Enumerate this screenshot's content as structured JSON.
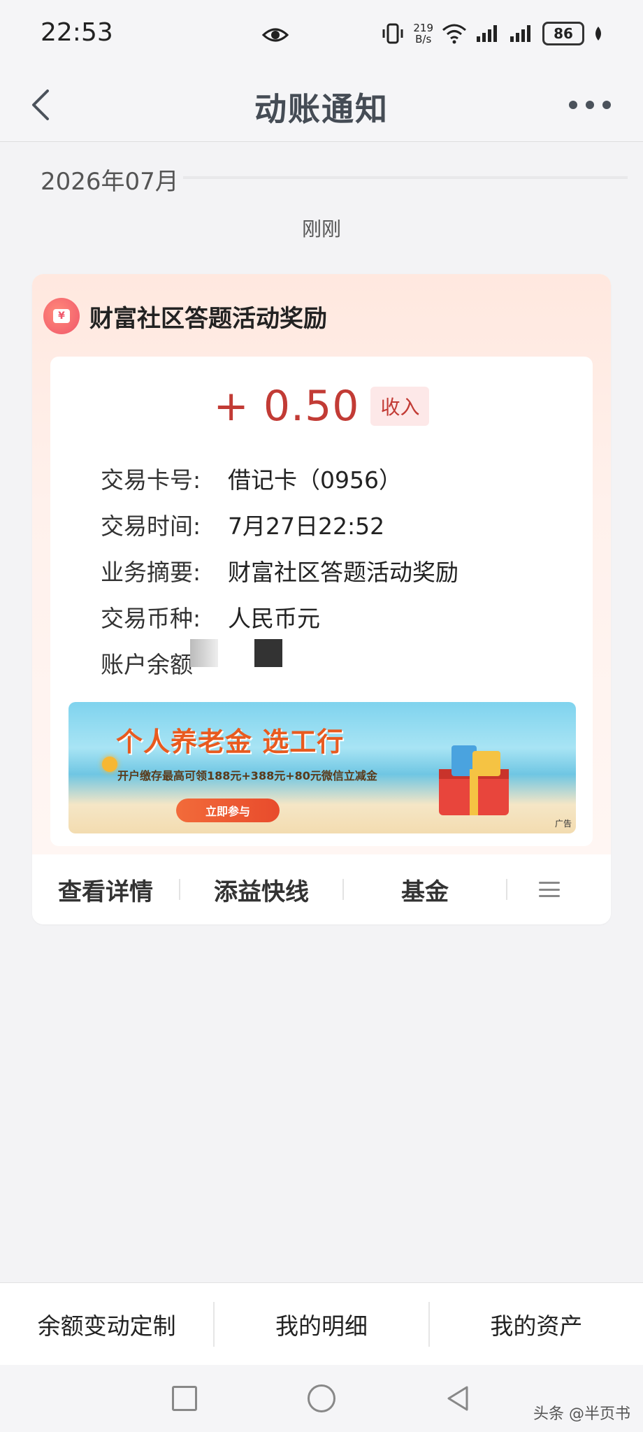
{
  "status_bar": {
    "time": "22:53",
    "net_speed_value": "219",
    "net_speed_unit": "B/s",
    "battery": "86",
    "icons": [
      "eye-icon",
      "vibrate-icon",
      "wifi-icon",
      "signal-icon",
      "signal-icon",
      "battery-icon",
      "leaf-icon"
    ]
  },
  "nav": {
    "title": "动账通知",
    "back_icon": "chevron-left-icon",
    "more_icon": "more-dots-icon"
  },
  "feed": {
    "month": "2026年07月",
    "time_label": "刚刚"
  },
  "card": {
    "icon": "yuan-tag-icon",
    "title": "财富社区答题活动奖励",
    "amount": "+ 0.50",
    "amount_type": "收入",
    "details": [
      {
        "label": "交易卡号:",
        "value": "借记卡（0956）"
      },
      {
        "label": "交易时间:",
        "value": "7月27日22:52"
      },
      {
        "label": "业务摘要:",
        "value": "财富社区答题活动奖励"
      },
      {
        "label": "交易币种:",
        "value": "人民币元"
      },
      {
        "label": "账户余额",
        "value": ""
      }
    ],
    "ad": {
      "headline": "个人养老金 选工行",
      "sub": "开户缴存最高可领188元+388元+80元微信立减金",
      "cta": "立即参与",
      "tag": "广告"
    },
    "actions": [
      "查看详情",
      "添益快线",
      "基金"
    ],
    "actions_menu_icon": "menu-icon"
  },
  "bottom_tabs": [
    "余额变动定制",
    "我的明细",
    "我的资产"
  ],
  "watermark": "头条 @半页书",
  "colors": {
    "amount": "#c23b35",
    "income_tag_bg": "#fde8e8",
    "nav_title": "#454c55"
  }
}
